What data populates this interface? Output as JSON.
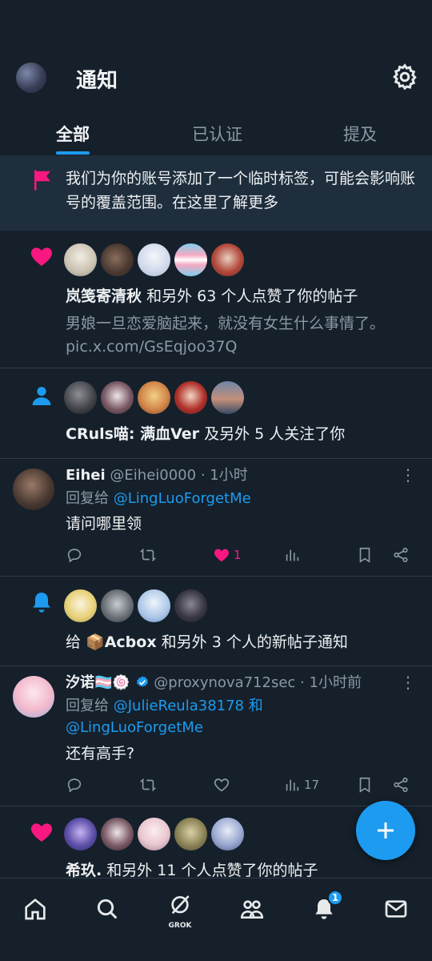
{
  "header": {
    "title": "通知",
    "settings_icon": "gear-icon"
  },
  "tabs": [
    {
      "label": "全部",
      "active": true
    },
    {
      "label": "已认证",
      "active": false
    },
    {
      "label": "提及",
      "active": false
    }
  ],
  "banner": {
    "icon": "flag-icon",
    "text": "我们为你的账号添加了一个临时标签，可能会影响账号的覆盖范围。在这里了解更多"
  },
  "notifications": [
    {
      "kind": "like",
      "name": "岚笺寄清秋",
      "action": "和另外 63 个人点赞了你的帖子",
      "excerpt": "男娘一旦恋爱脑起来，就没有女生什么事情了。",
      "link": "pic.x.com/GsEqjoo37Q"
    },
    {
      "kind": "follow",
      "name": "CRuls喵: 满血Ver",
      "action": "及另外 5 人关注了你"
    },
    {
      "kind": "bell",
      "prefix": "给",
      "name": "📦Acbox",
      "action": "和另外 3 个人的新帖子通知"
    },
    {
      "kind": "like",
      "name": "希玖.",
      "action": "和另外 11 个人点赞了你的帖子"
    }
  ],
  "posts": [
    {
      "name": "Eihei",
      "handle": "@Eihei0000",
      "time": "· 1小时",
      "reply_prefix": "回复给",
      "reply_to": "@LingLuoForgetMe",
      "body": "请问哪里领",
      "likes": "1",
      "liked": true,
      "views": ""
    },
    {
      "name": "汐诺🏳️‍⚧️🍥",
      "handle": "@proxynova712sec",
      "time": "· 1小时前",
      "reply_prefix": "回复给",
      "reply_to": "@JulieReula38178 和",
      "reply_to_2": "@LingLuoForgetMe",
      "body": "还有高手?",
      "likes": "",
      "liked": false,
      "views": "17"
    }
  ],
  "bottom_nav": {
    "items": [
      "home-icon",
      "search-icon",
      "grok-icon",
      "communities-icon",
      "notifications-icon",
      "messages-icon"
    ],
    "grok_label": "GROK",
    "notification_badge": "1"
  },
  "colors": {
    "background": "#15202b",
    "accent": "#1d9bf0",
    "like": "#f91880",
    "muted": "#8b98a5"
  }
}
